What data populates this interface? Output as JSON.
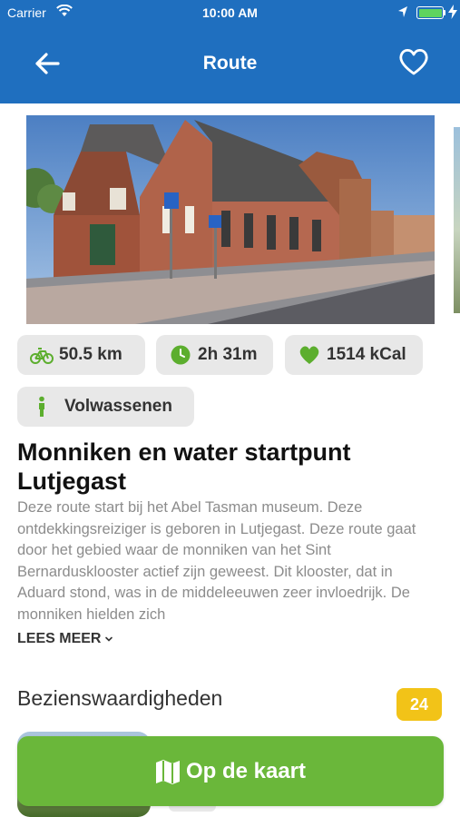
{
  "status_bar": {
    "carrier": "Carrier",
    "time": "10:00 AM",
    "icons": [
      "wifi-icon",
      "location-arrow-icon",
      "battery-icon",
      "charging-bolt-icon"
    ]
  },
  "nav": {
    "title": "Route",
    "back_icon": "arrow-left-icon",
    "favorite_icon": "heart-outline-icon"
  },
  "hero_image": {
    "subject": "brick buildings along a village street"
  },
  "stats": {
    "distance": "50.5 km",
    "duration": "2h 31m",
    "calories": "1514 kCal",
    "audience": "Volwassenen",
    "icons": [
      "bicycle-icon",
      "clock-icon",
      "heart-icon",
      "person-icon"
    ]
  },
  "route": {
    "title": "Monniken en water startpunt Lutjegast",
    "description": "Deze route start bij het Abel Tasman museum. Deze ontdekkingsreiziger is geboren in Lutjegast. Deze route gaat door het gebied waar de monniken van het Sint Bernardusklooster actief zijn geweest. Dit klooster, dat in Aduard stond, was in de middeleeuwen zeer invloedrijk. De monniken hielden zich",
    "read_more": "LEES MEER"
  },
  "sights": {
    "title": "Bezienswaardigheden",
    "count": "24"
  },
  "cta": {
    "label": "Op de kaart",
    "icon": "map-icon"
  },
  "colors": {
    "header": "#1f6fbf",
    "cta": "#6ab73a",
    "badge": "#f2c318",
    "chip": "#e8e8e8",
    "icon_green": "#5cae2e"
  }
}
